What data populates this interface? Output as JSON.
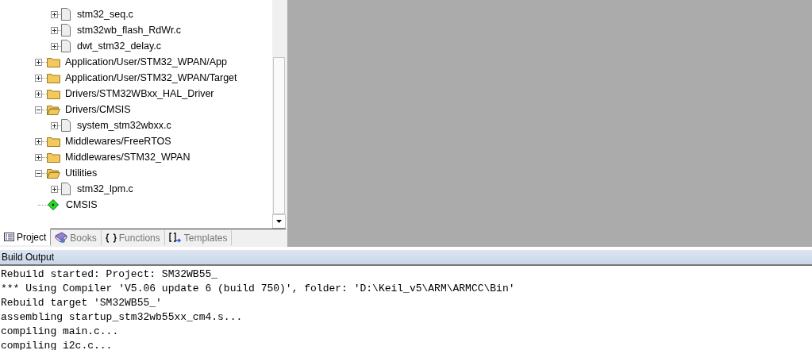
{
  "project_tree": {
    "items": [
      {
        "kind": "group",
        "children": [
          {
            "kind": "file",
            "label": "stm32_seq.c",
            "expanded": false
          },
          {
            "kind": "file",
            "label": "stm32wb_flash_RdWr.c",
            "expanded": false
          },
          {
            "kind": "file",
            "label": "dwt_stm32_delay.c",
            "expanded": false
          }
        ]
      },
      {
        "kind": "folder",
        "label": "Application/User/STM32_WPAN/App",
        "expanded": false
      },
      {
        "kind": "folder",
        "label": "Application/User/STM32_WPAN/Target",
        "expanded": false
      },
      {
        "kind": "folder",
        "label": "Drivers/STM32WBxx_HAL_Driver",
        "expanded": false
      },
      {
        "kind": "folder",
        "label": "Drivers/CMSIS",
        "expanded": true,
        "children": [
          {
            "kind": "file",
            "label": "system_stm32wbxx.c",
            "expanded": false
          }
        ]
      },
      {
        "kind": "folder",
        "label": "Middlewares/FreeRTOS",
        "expanded": false
      },
      {
        "kind": "folder",
        "label": "Middlewares/STM32_WPAN",
        "expanded": false
      },
      {
        "kind": "folder",
        "label": "Utilities",
        "expanded": true,
        "children": [
          {
            "kind": "file",
            "label": "stm32_lpm.c",
            "expanded": false
          }
        ]
      },
      {
        "kind": "component",
        "label": "CMSIS"
      }
    ]
  },
  "panel_tabs": [
    {
      "kind": "project",
      "label": "Project",
      "selected": true
    },
    {
      "kind": "books",
      "label": "Books",
      "selected": false
    },
    {
      "kind": "functions",
      "label": "Functions",
      "selected": false
    },
    {
      "kind": "templates",
      "label": "Templates",
      "selected": false
    }
  ],
  "build_output": {
    "title": "Build Output",
    "lines": [
      "Rebuild started: Project: SM32WB55_",
      "*** Using Compiler 'V5.06 update 6 (build 750)', folder: 'D:\\Keil_v5\\ARM\\ARMCC\\Bin'",
      "Rebuild target 'SM32WB55_'",
      "assembling startup_stm32wb55xx_cm4.s...",
      "compiling main.c...",
      "compiling i2c.c..."
    ]
  }
}
